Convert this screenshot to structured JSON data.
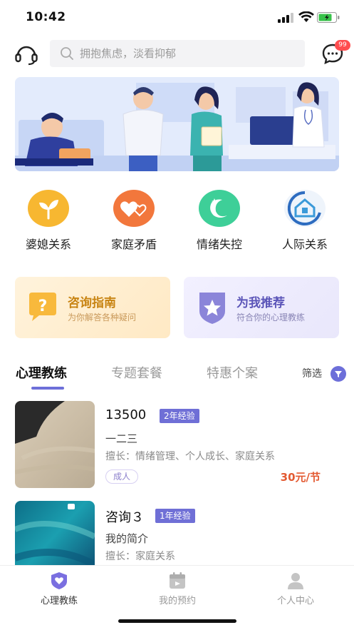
{
  "status_bar": {
    "time": "10:42"
  },
  "header": {
    "search_placeholder": "拥抱焦虑，淡看抑郁",
    "message_badge": "99"
  },
  "categories": [
    {
      "label": "婆媳关系",
      "icon": "sprout-icon",
      "color": "#f7b731"
    },
    {
      "label": "家庭矛盾",
      "icon": "hearts-icon",
      "color": "#f2773c"
    },
    {
      "label": "情绪失控",
      "icon": "moon-icon",
      "color": "#3ecf98"
    },
    {
      "label": "人际关系",
      "icon": "house-ring-icon",
      "color": "#3b78c9"
    }
  ],
  "promos": [
    {
      "title": "咨询指南",
      "subtitle": "为你解答各种疑问"
    },
    {
      "title": "为我推荐",
      "subtitle": "符合你的心理教练"
    }
  ],
  "tabs": [
    {
      "label": "心理教练",
      "active": true
    },
    {
      "label": "专题套餐",
      "active": false
    },
    {
      "label": "特惠个案",
      "active": false
    }
  ],
  "filter_label": "筛选",
  "coaches": [
    {
      "name": "13500",
      "experience": "2年经验",
      "intro": "一二三",
      "specialties": "擅长：情绪管理、个人成长、家庭关系",
      "tag": "成人",
      "price": "30元/节"
    },
    {
      "name": "咨询３",
      "experience": "1年经验",
      "intro": "我的简介",
      "specialties": "擅长：家庭关系"
    }
  ],
  "bottom_nav": [
    {
      "label": "心理教练",
      "active": true
    },
    {
      "label": "我的预约",
      "active": false
    },
    {
      "label": "个人中心",
      "active": false
    }
  ],
  "colors": {
    "accent": "#6d6fd9",
    "price": "#e35a32",
    "badge": "#ff4d4f"
  }
}
